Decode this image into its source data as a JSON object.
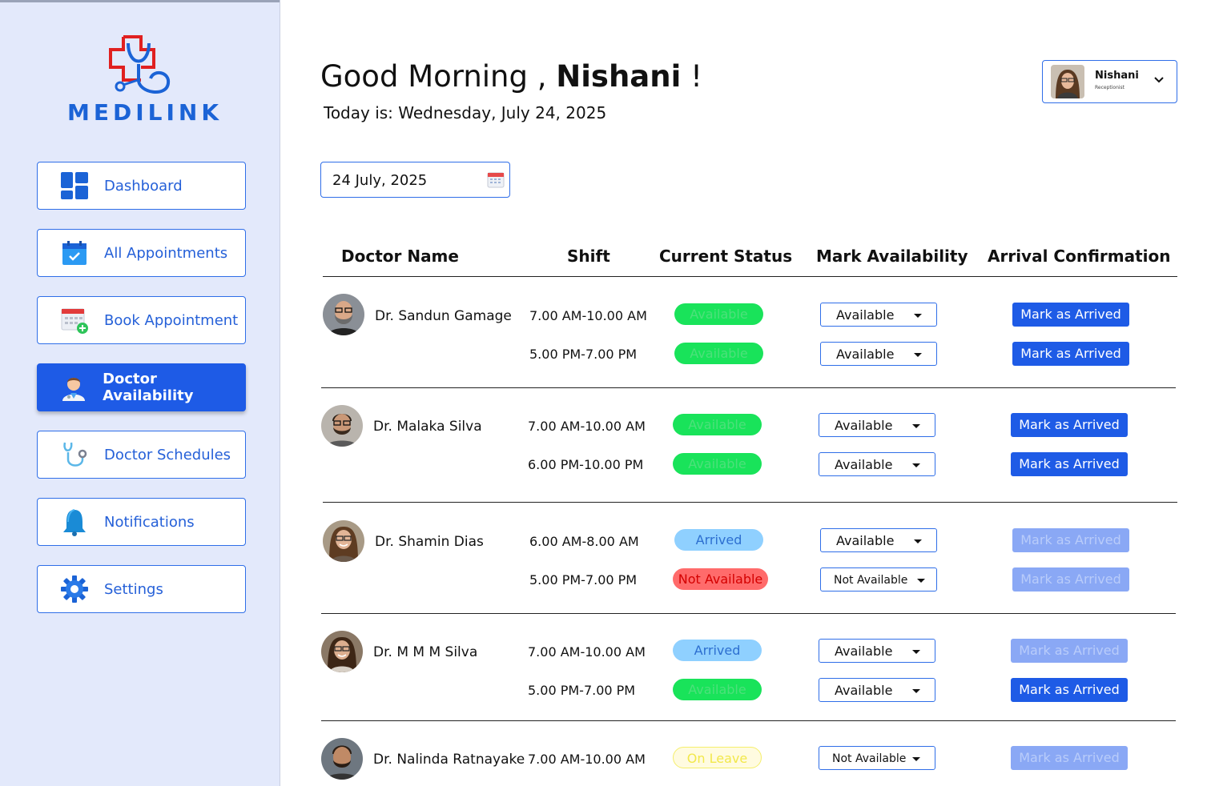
{
  "brand": {
    "name": "MEDILINK"
  },
  "sidebar": {
    "items": [
      {
        "label": "Dashboard",
        "icon": "dashboard-grid-icon"
      },
      {
        "label": "All Appointments",
        "icon": "calendar-check-icon"
      },
      {
        "label": "Book Appointment",
        "icon": "calendar-add-icon"
      },
      {
        "label": "Doctor Availability",
        "icon": "doctor-icon",
        "active": true
      },
      {
        "label": "Doctor Schedules",
        "icon": "stethoscope-icon"
      },
      {
        "label": "Notifications",
        "icon": "bell-icon"
      },
      {
        "label": "Settings",
        "icon": "gear-icon"
      }
    ]
  },
  "header": {
    "greeting_prefix": "Good Morning ,",
    "user_first": "Nishani",
    "greeting_suffix": "!",
    "today": "Today is: Wednesday, July 24, 2025"
  },
  "user": {
    "name": "Nishani",
    "role": "Receptionist"
  },
  "date_picker": {
    "value": "24 July, 2025"
  },
  "table": {
    "headers": [
      "Doctor Name",
      "Shift",
      "Current Status",
      "Mark Availability",
      "Arrival Confirmation"
    ],
    "button_label": "Mark as Arrived",
    "doctors": [
      {
        "name": "Dr. Sandun Gamage",
        "shifts": [
          {
            "time": "7.00 AM-10.00 AM",
            "status": "Available",
            "availability": "Available",
            "arrived_enabled": true
          },
          {
            "time": "5.00 PM-7.00 PM",
            "status": "Available",
            "availability": "Available",
            "arrived_enabled": true
          }
        ]
      },
      {
        "name": "Dr. Malaka Silva",
        "shifts": [
          {
            "time": "7.00 AM-10.00 AM",
            "status": "Available",
            "availability": "Available",
            "arrived_enabled": true
          },
          {
            "time": "6.00 PM-10.00 PM",
            "status": "Available",
            "availability": "Available",
            "arrived_enabled": true
          }
        ]
      },
      {
        "name": "Dr. Shamin Dias",
        "shifts": [
          {
            "time": "6.00 AM-8.00 AM",
            "status": "Arrived",
            "availability": "Available",
            "arrived_enabled": false
          },
          {
            "time": "5.00 PM-7.00 PM",
            "status": "Not Available",
            "availability": "Not Available",
            "arrived_enabled": false
          }
        ]
      },
      {
        "name": "Dr. M M M Silva",
        "shifts": [
          {
            "time": "7.00 AM-10.00 AM",
            "status": "Arrived",
            "availability": "Available",
            "arrived_enabled": false
          },
          {
            "time": "5.00 PM-7.00 PM",
            "status": "Available",
            "availability": "Available",
            "arrived_enabled": true
          }
        ]
      },
      {
        "name": "Dr. Nalinda Ratnayake",
        "shifts": [
          {
            "time": "7.00 AM-10.00 AM",
            "status": "On Leave",
            "availability": "Not Available",
            "arrived_enabled": false
          }
        ]
      }
    ]
  },
  "colors": {
    "primary": "#1e5be6",
    "available": "#19e35a",
    "arrived": "#8fd0ff",
    "not_available": "#ff6b6b",
    "on_leave": "#fffbe0"
  }
}
